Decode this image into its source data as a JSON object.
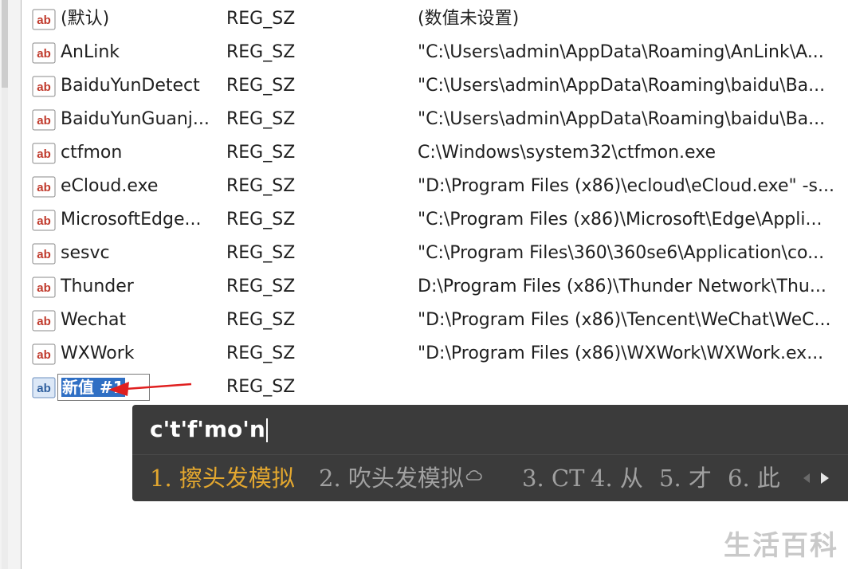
{
  "entries": [
    {
      "name": "(默认)",
      "type": "REG_SZ",
      "data": "(数值未设置)"
    },
    {
      "name": "AnLink",
      "type": "REG_SZ",
      "data": "\"C:\\Users\\admin\\AppData\\Roaming\\AnLink\\A..."
    },
    {
      "name": "BaiduYunDetect",
      "type": "REG_SZ",
      "data": "\"C:\\Users\\admin\\AppData\\Roaming\\baidu\\Ba..."
    },
    {
      "name": "BaiduYunGuanj...",
      "type": "REG_SZ",
      "data": "\"C:\\Users\\admin\\AppData\\Roaming\\baidu\\Ba..."
    },
    {
      "name": "ctfmon",
      "type": "REG_SZ",
      "data": "C:\\Windows\\system32\\ctfmon.exe"
    },
    {
      "name": "eCloud.exe",
      "type": "REG_SZ",
      "data": "\"D:\\Program Files (x86)\\ecloud\\eCloud.exe\" -s..."
    },
    {
      "name": "MicrosoftEdge...",
      "type": "REG_SZ",
      "data": "\"C:\\Program Files (x86)\\Microsoft\\Edge\\Appli..."
    },
    {
      "name": "sesvc",
      "type": "REG_SZ",
      "data": "\"C:\\Program Files\\360\\360se6\\Application\\co..."
    },
    {
      "name": "Thunder",
      "type": "REG_SZ",
      "data": "D:\\Program Files (x86)\\Thunder Network\\Thu..."
    },
    {
      "name": "Wechat",
      "type": "REG_SZ",
      "data": "\"D:\\Program Files (x86)\\Tencent\\WeChat\\WeC..."
    },
    {
      "name": "WXWork",
      "type": "REG_SZ",
      "data": "\"D:\\Program Files (x86)\\WXWork\\WXWork.ex..."
    }
  ],
  "new_entry": {
    "name": "新值 #1",
    "type": "REG_SZ"
  },
  "icon_text": "ab",
  "ime": {
    "input": "c't'f'mo'n",
    "candidates": [
      "1. 擦头发模拟",
      "2. 吹头发模拟",
      "3. CT",
      "4. 从",
      "5. 才",
      "6. 此"
    ]
  },
  "watermark": "生活百科",
  "colors": {
    "accent": "#2f6fc4",
    "arrow": "#e02020",
    "ime_bg": "#3b3b3b",
    "ime_active": "#e3a72f"
  }
}
